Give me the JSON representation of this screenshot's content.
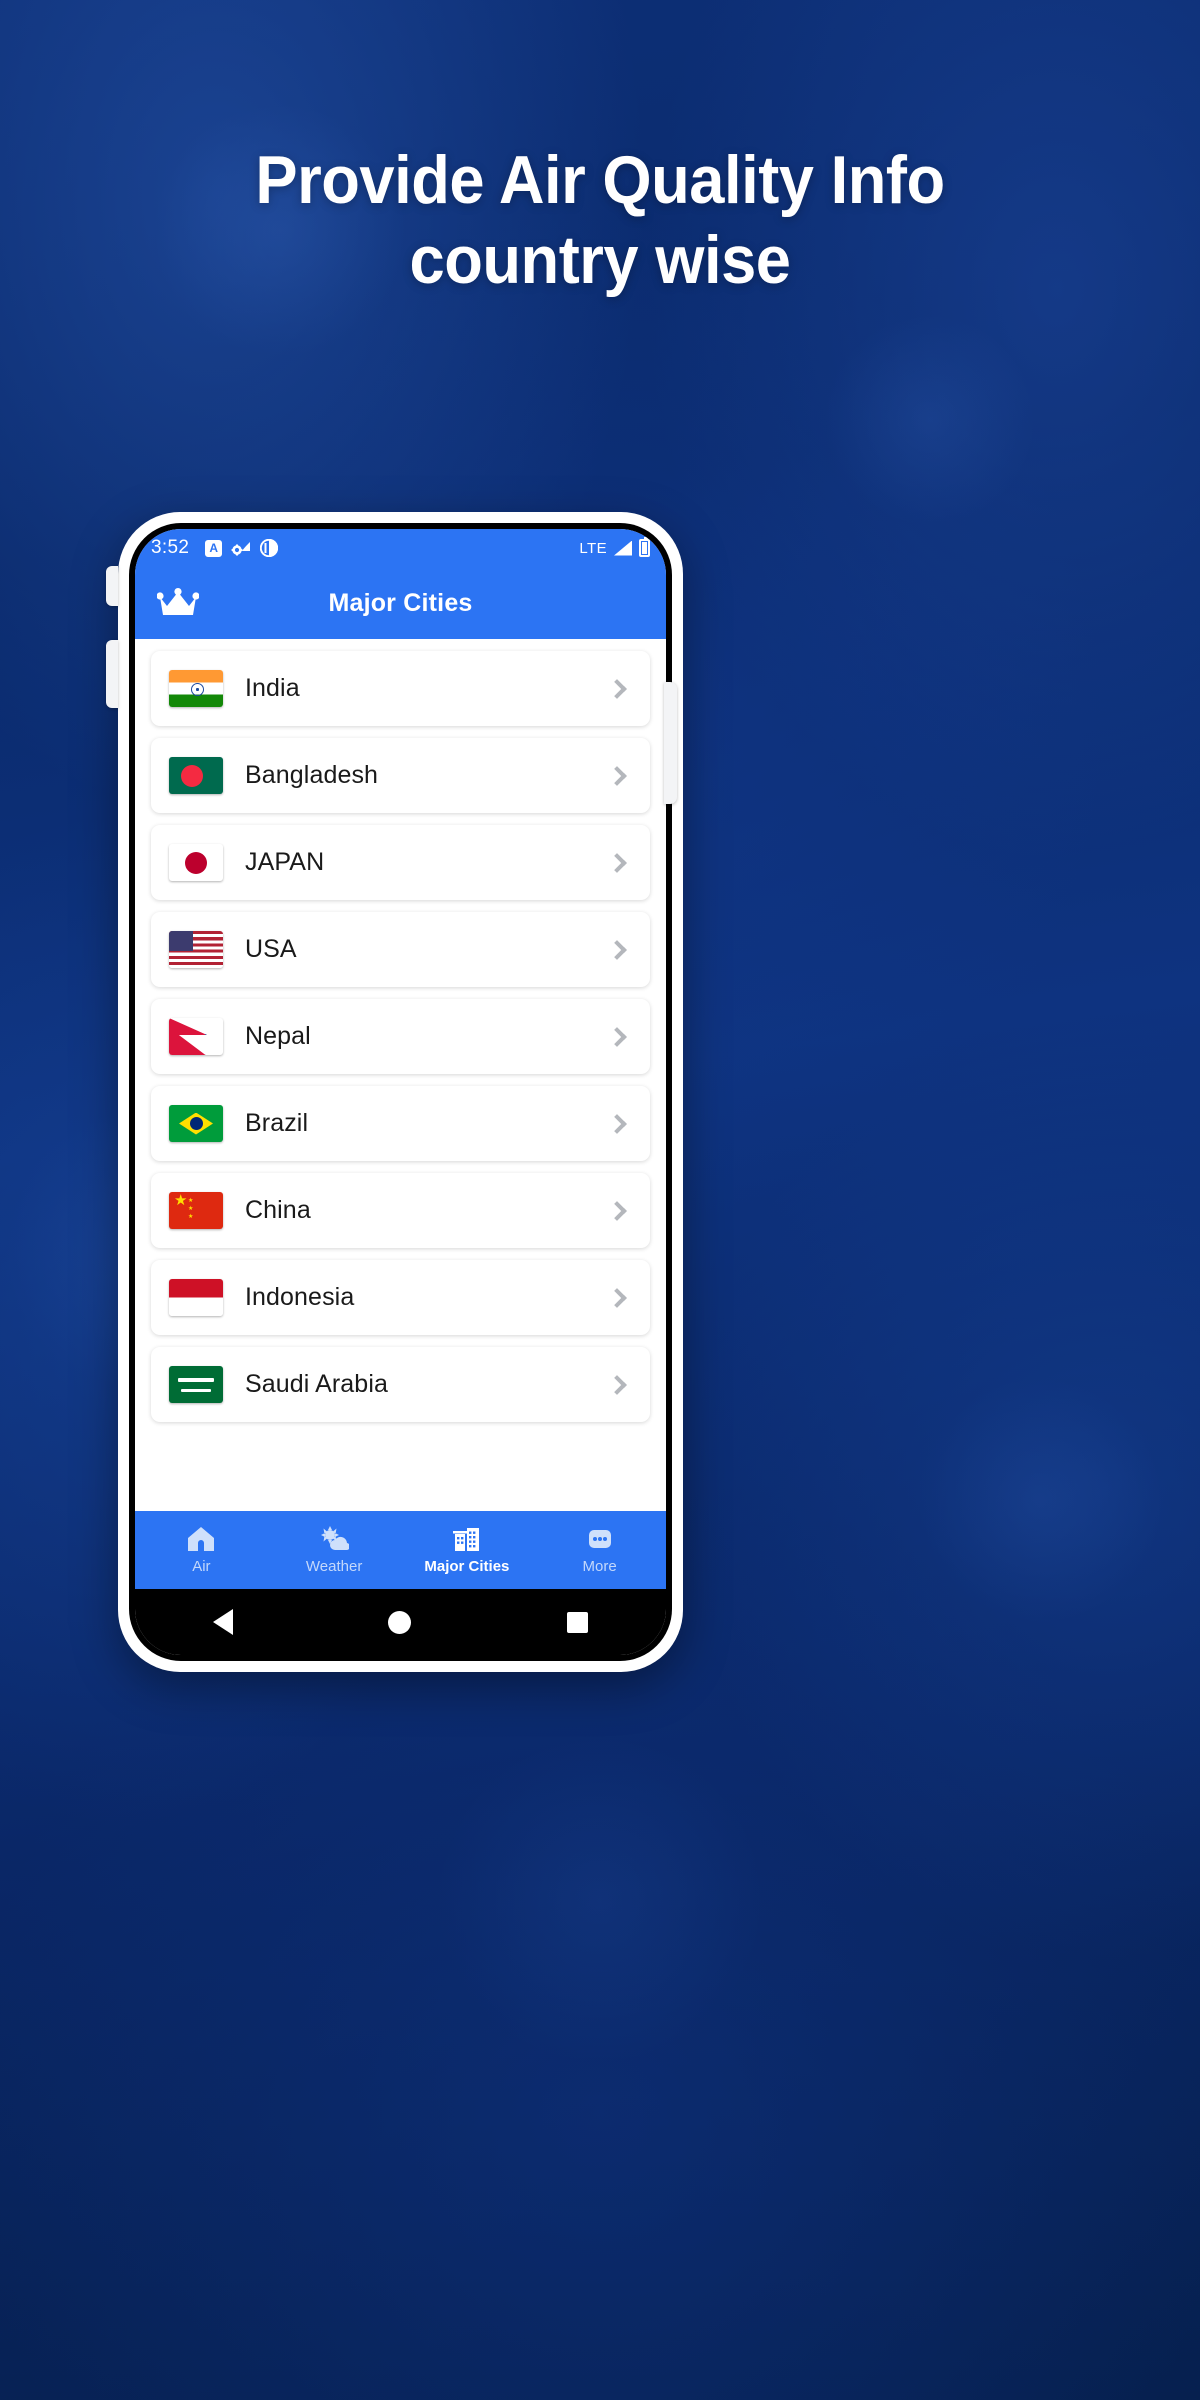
{
  "promo": {
    "headline_line1": "Provide Air Quality Info",
    "headline_line2": "country wise",
    "background_color": "#0b2d73",
    "accent_color": "#2c74f3"
  },
  "status_bar": {
    "time": "3:52",
    "network_label": "LTE",
    "icons": [
      "letter-a-badge-icon",
      "gear-wifi-icon",
      "notification-icon",
      "signal-bars-icon",
      "battery-icon"
    ]
  },
  "app_bar": {
    "title": "Major Cities",
    "leading_icon": "crown-icon"
  },
  "country_list": {
    "items": [
      {
        "name": "India",
        "flag": "f-india",
        "chevron": "chevron-right-icon"
      },
      {
        "name": "Bangladesh",
        "flag": "f-bangladesh",
        "chevron": "chevron-right-icon"
      },
      {
        "name": "JAPAN",
        "flag": "f-japan",
        "chevron": "chevron-right-icon"
      },
      {
        "name": "USA",
        "flag": "f-usa",
        "chevron": "chevron-right-icon"
      },
      {
        "name": "Nepal",
        "flag": "f-nepal",
        "chevron": "chevron-right-icon"
      },
      {
        "name": "Brazil",
        "flag": "f-brazil",
        "chevron": "chevron-right-icon"
      },
      {
        "name": "China",
        "flag": "f-china",
        "chevron": "chevron-right-icon"
      },
      {
        "name": "Indonesia",
        "flag": "f-indonesia",
        "chevron": "chevron-right-icon"
      },
      {
        "name": "Saudi Arabia",
        "flag": "f-saudi",
        "chevron": "chevron-right-icon"
      }
    ]
  },
  "bottom_nav": {
    "items": [
      {
        "label": "Air",
        "icon": "home-icon",
        "active": false
      },
      {
        "label": "Weather",
        "icon": "sun-cloud-icon",
        "active": false
      },
      {
        "label": "Major Cities",
        "icon": "buildings-icon",
        "active": true
      },
      {
        "label": "More",
        "icon": "more-dots-icon",
        "active": false
      }
    ]
  },
  "system_nav": {
    "back": "back-triangle-icon",
    "home": "home-circle-icon",
    "recents": "recents-square-icon"
  }
}
